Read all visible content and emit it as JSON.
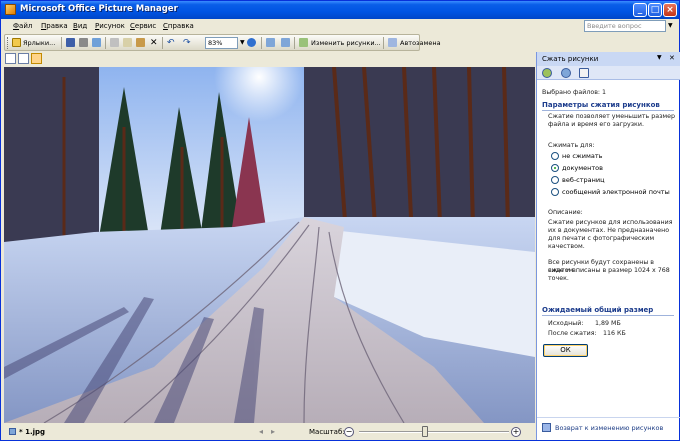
{
  "window": {
    "title": "Microsoft Office Picture Manager"
  },
  "menu": [
    "Файл",
    "Правка",
    "Вид",
    "Рисунок",
    "Сервис",
    "Справка"
  ],
  "help_placeholder": "Введите вопрос",
  "toolbar": {
    "shortcuts_label": "Ярлыки...",
    "zoom_value": "83%",
    "edit_label": "Изменить рисунки...",
    "autocorrect_label": "Автозамена"
  },
  "status": {
    "file_name": "* 1.jpg",
    "zoom_label": "Масштаб:",
    "zoom_slider_fraction": 0.44
  },
  "pane": {
    "title": "Сжать рисунки",
    "selected": "Выбрано файлов: 1",
    "section_params": "Параметры сжатия рисунков",
    "desc1": [
      "Сжатие позволяет уменьшить размер",
      "файла и время его загрузки."
    ],
    "compress_for": "Сжимать для:",
    "options": [
      {
        "label": "не сжимать",
        "checked": false
      },
      {
        "label": "документов",
        "checked": true
      },
      {
        "label": "веб-страниц",
        "checked": false
      },
      {
        "label": "сообщений электронной почты",
        "checked": false
      }
    ],
    "description_title": "Описание:",
    "description": [
      "Сжатие рисунков для использования",
      "их в документах. Не предназначено",
      "для печати с фотографическим",
      "качеством."
    ],
    "description2": [
      "Все рисунки будут сохранены в сжатом",
      "виде и вписаны в размер 1024 x 768",
      "точек."
    ],
    "section_size": "Ожидаемый общий размер",
    "original_label": "Исходный:",
    "original_value": "1,89 МБ",
    "after_label": "После сжатия:",
    "after_value": "116 КБ",
    "ok_label": "ОК",
    "back_link": "Возврат к изменению рисунков"
  },
  "colors": {
    "titlebar": "#0054e3",
    "pane_header": "#c9d8f4",
    "section_text": "#1c3c8c"
  }
}
